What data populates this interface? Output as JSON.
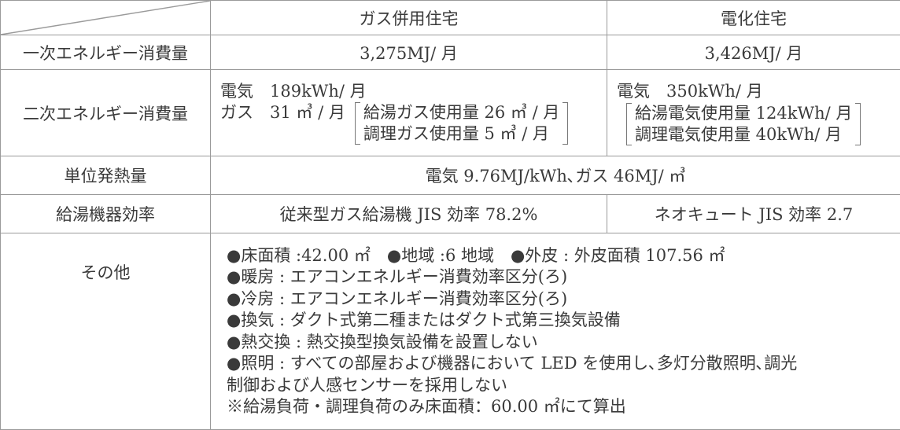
{
  "header": {
    "col1": "ガス併用住宅",
    "col2": "電化住宅"
  },
  "rows": {
    "primary": {
      "label": "一次エネルギー消費量",
      "gas": "3,275MJ/ 月",
      "electric": "3,426MJ/ 月"
    },
    "secondary": {
      "label": "二次エネルギー消費量",
      "gas": {
        "line1": "電気　189kWh/ 月",
        "line2_prefix": "ガス　31 ㎥ / 月",
        "detail1": "給湯ガス使用量 26 ㎥ / 月",
        "detail2": "調理ガス使用量 5 ㎥ / 月"
      },
      "electric": {
        "line1": "電気　350kWh/ 月",
        "detail1": "給湯電気使用量 124kWh/ 月",
        "detail2": "調理電気使用量 40kWh/ 月"
      }
    },
    "heat_unit": {
      "label": "単位発熱量",
      "value": "電気 9.76MJ/kWh､ガス 46MJ/ ㎥"
    },
    "efficiency": {
      "label": "給湯機器効率",
      "gas": "従来型ガス給湯機 JIS 効率 78.2%",
      "electric": "ネオキュート JIS 効率 2.7"
    },
    "other": {
      "label": "その他",
      "lines": [
        "●床面積 :42.00 ㎡　●地域 :6 地域　●外皮 : 外皮面積 107.56 ㎡",
        "●暖房 : エアコンエネルギー消費効率区分(ろ)",
        "●冷房 : エアコンエネルギー消費効率区分(ろ)",
        "●換気 : ダクト式第二種またはダクト式第三換気設備",
        "●熱交換 : 熱交換型換気設備を設置しない",
        "●照明 : すべての部屋および機器において LED を使用し､多灯分散照明､調光",
        "制御および人感センサーを採用しない",
        "※給湯負荷・調理負荷のみ床面積：60.00 ㎡にて算出"
      ]
    }
  }
}
